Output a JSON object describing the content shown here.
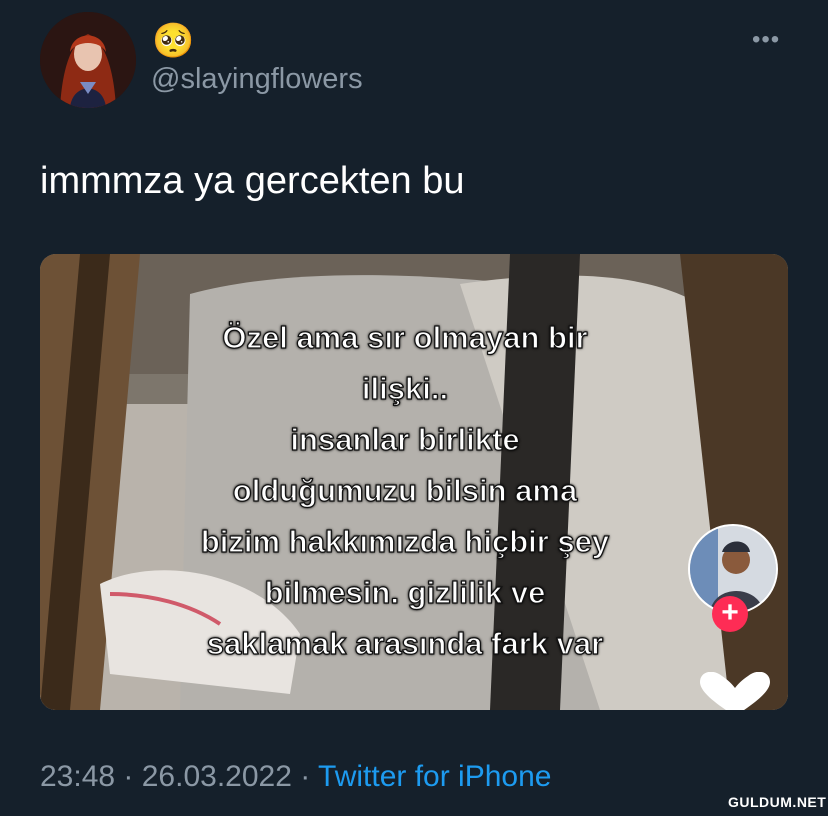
{
  "author": {
    "avatar_icon": "profile-avatar-illustration",
    "display_name": "🥺",
    "handle": "@slayingflowers"
  },
  "more_icon": "more-options-icon",
  "tweet": {
    "text": "immmza ya gercekten bu"
  },
  "media": {
    "caption_lines": [
      "Özel ama sır olmayan bir",
      "ilişki..",
      "insanlar birlikte",
      "olduğumuzu bilsin ama",
      "bizim hakkımızda hiçbir şey",
      "bilmesin.  gizlilik ve",
      "saklamak arasında fark var"
    ],
    "follow_label": "+"
  },
  "footer": {
    "time": "23:48",
    "separator1": " · ",
    "date": "26.03.2022",
    "separator2": " · ",
    "source": "Twitter for iPhone"
  },
  "watermark": "GULDUM.NET",
  "colors": {
    "background": "#15202b",
    "secondary_text": "#8b98a5",
    "link": "#1d9bf0",
    "tiktok_follow": "#fe2c55"
  }
}
